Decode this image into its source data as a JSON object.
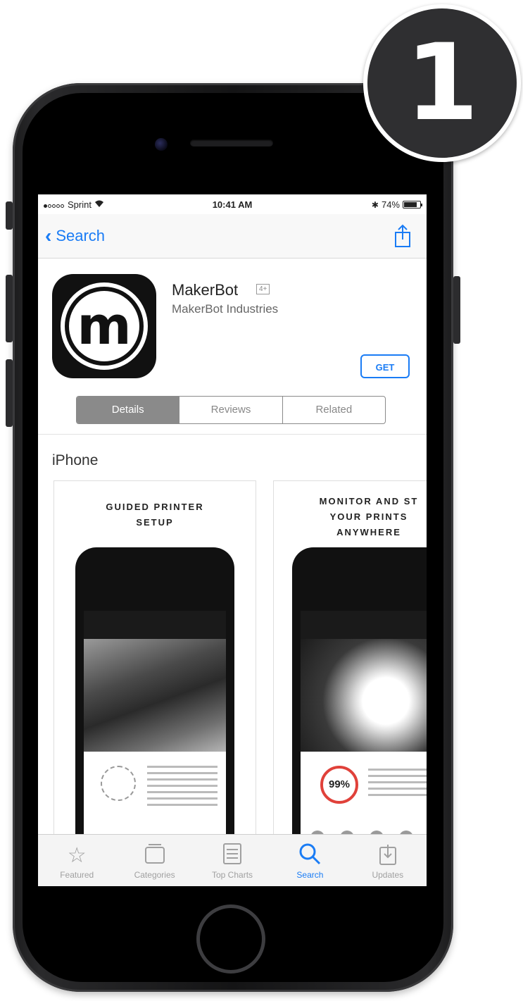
{
  "badge": {
    "number": "1"
  },
  "status_bar": {
    "carrier": "Sprint",
    "time": "10:41 AM",
    "battery": "74%"
  },
  "nav": {
    "back_label": "Search"
  },
  "app": {
    "name": "MakerBot",
    "age_rating": "4+",
    "developer": "MakerBot Industries",
    "get_label": "GET",
    "icon_letter": "m"
  },
  "segments": [
    {
      "label": "Details",
      "active": true
    },
    {
      "label": "Reviews",
      "active": false
    },
    {
      "label": "Related",
      "active": false
    }
  ],
  "screenshots": {
    "section_label": "iPhone",
    "items": [
      {
        "caption": "GUIDED PRINTER\nSETUP"
      },
      {
        "caption": "MONITOR AND ST\nYOUR PRINTS\nANYWHERE",
        "progress_text": "99%"
      }
    ]
  },
  "tabbar": {
    "items": [
      {
        "label": "Featured",
        "icon": "star-icon",
        "active": false
      },
      {
        "label": "Categories",
        "icon": "categories-icon",
        "active": false
      },
      {
        "label": "Top Charts",
        "icon": "list-icon",
        "active": false
      },
      {
        "label": "Search",
        "icon": "search-icon",
        "active": true
      },
      {
        "label": "Updates",
        "icon": "updates-icon",
        "active": false
      }
    ]
  },
  "colors": {
    "accent": "#1a7cf5",
    "phone_body": "#1c1c1d",
    "badge_bg": "#2f2f31"
  }
}
